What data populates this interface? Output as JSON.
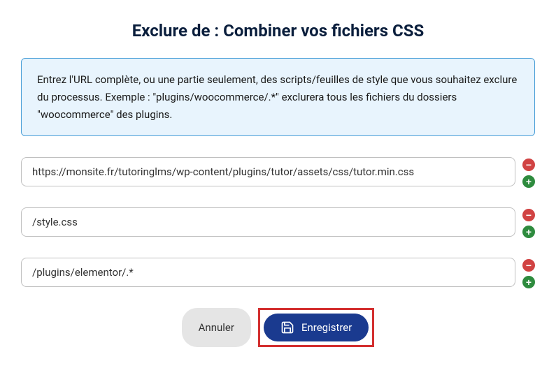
{
  "dialog": {
    "title": "Exclure de : Combiner vos fichiers CSS",
    "info_text": "Entrez l'URL complète, ou une partie seulement, des scripts/feuilles de style que vous souhaitez exclure du processus. Exemple : \"plugins/woocommerce/.*\" exclurera tous les fichiers du dossiers \"woocommerce\" des plugins."
  },
  "inputs": [
    {
      "value": "https://monsite.fr/tutoringlms/wp-content/plugins/tutor/assets/css/tutor.min.css"
    },
    {
      "value": "/style.css"
    },
    {
      "value": "/plugins/elementor/.*"
    }
  ],
  "actions": {
    "cancel_label": "Annuler",
    "save_label": "Enregistrer"
  },
  "icons": {
    "remove": "−",
    "add": "+"
  }
}
